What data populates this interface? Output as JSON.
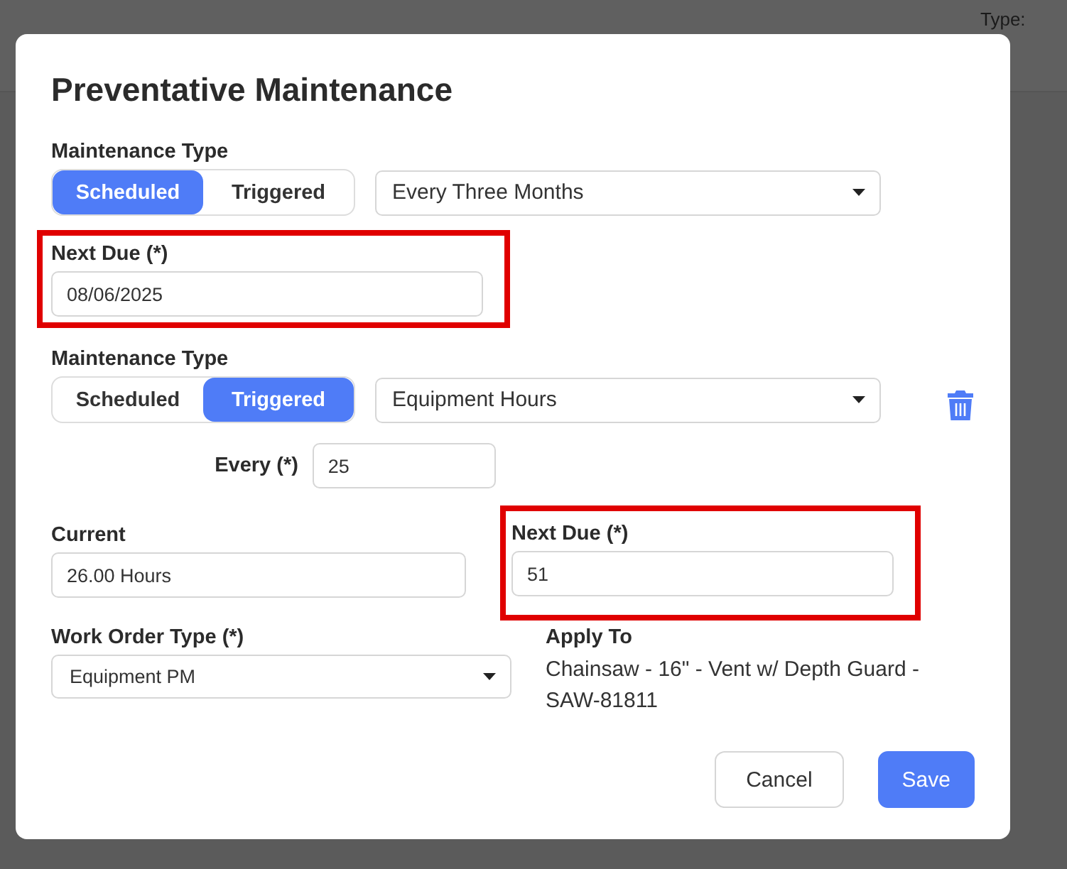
{
  "background": {
    "label": "Type:"
  },
  "dialog": {
    "title": "Preventative Maintenance",
    "schedules": [
      {
        "kind": "scheduled",
        "type_label": "Maintenance Type",
        "options": [
          {
            "label": "Scheduled",
            "selected": true
          },
          {
            "label": "Triggered",
            "selected": false
          }
        ],
        "interval": "Every Three Months",
        "removable": false,
        "next_due": {
          "label": "Next Due (*)",
          "value": "08/06/2025",
          "highlighted": true
        }
      },
      {
        "kind": "triggered",
        "type_label": "Maintenance Type",
        "options": [
          {
            "label": "Scheduled",
            "selected": false
          },
          {
            "label": "Triggered",
            "selected": true
          }
        ],
        "interval": "Equipment Hours",
        "removable": true,
        "every": {
          "label": "Every (*)",
          "value": "25"
        },
        "current": {
          "label": "Current",
          "value": "26.00 Hours"
        },
        "next_due": {
          "label": "Next Due (*)",
          "value": "51",
          "highlighted": true
        }
      }
    ],
    "work_order_type": {
      "label": "Work Order Type (*)",
      "value": "Equipment PM"
    },
    "apply_to": {
      "label": "Apply To",
      "value": "Chainsaw - 16\" - Vent w/ Depth Guard - SAW-81811"
    },
    "buttons": [
      {
        "label": "Cancel",
        "kind": "secondary"
      },
      {
        "label": "Save",
        "kind": "primary"
      }
    ]
  }
}
